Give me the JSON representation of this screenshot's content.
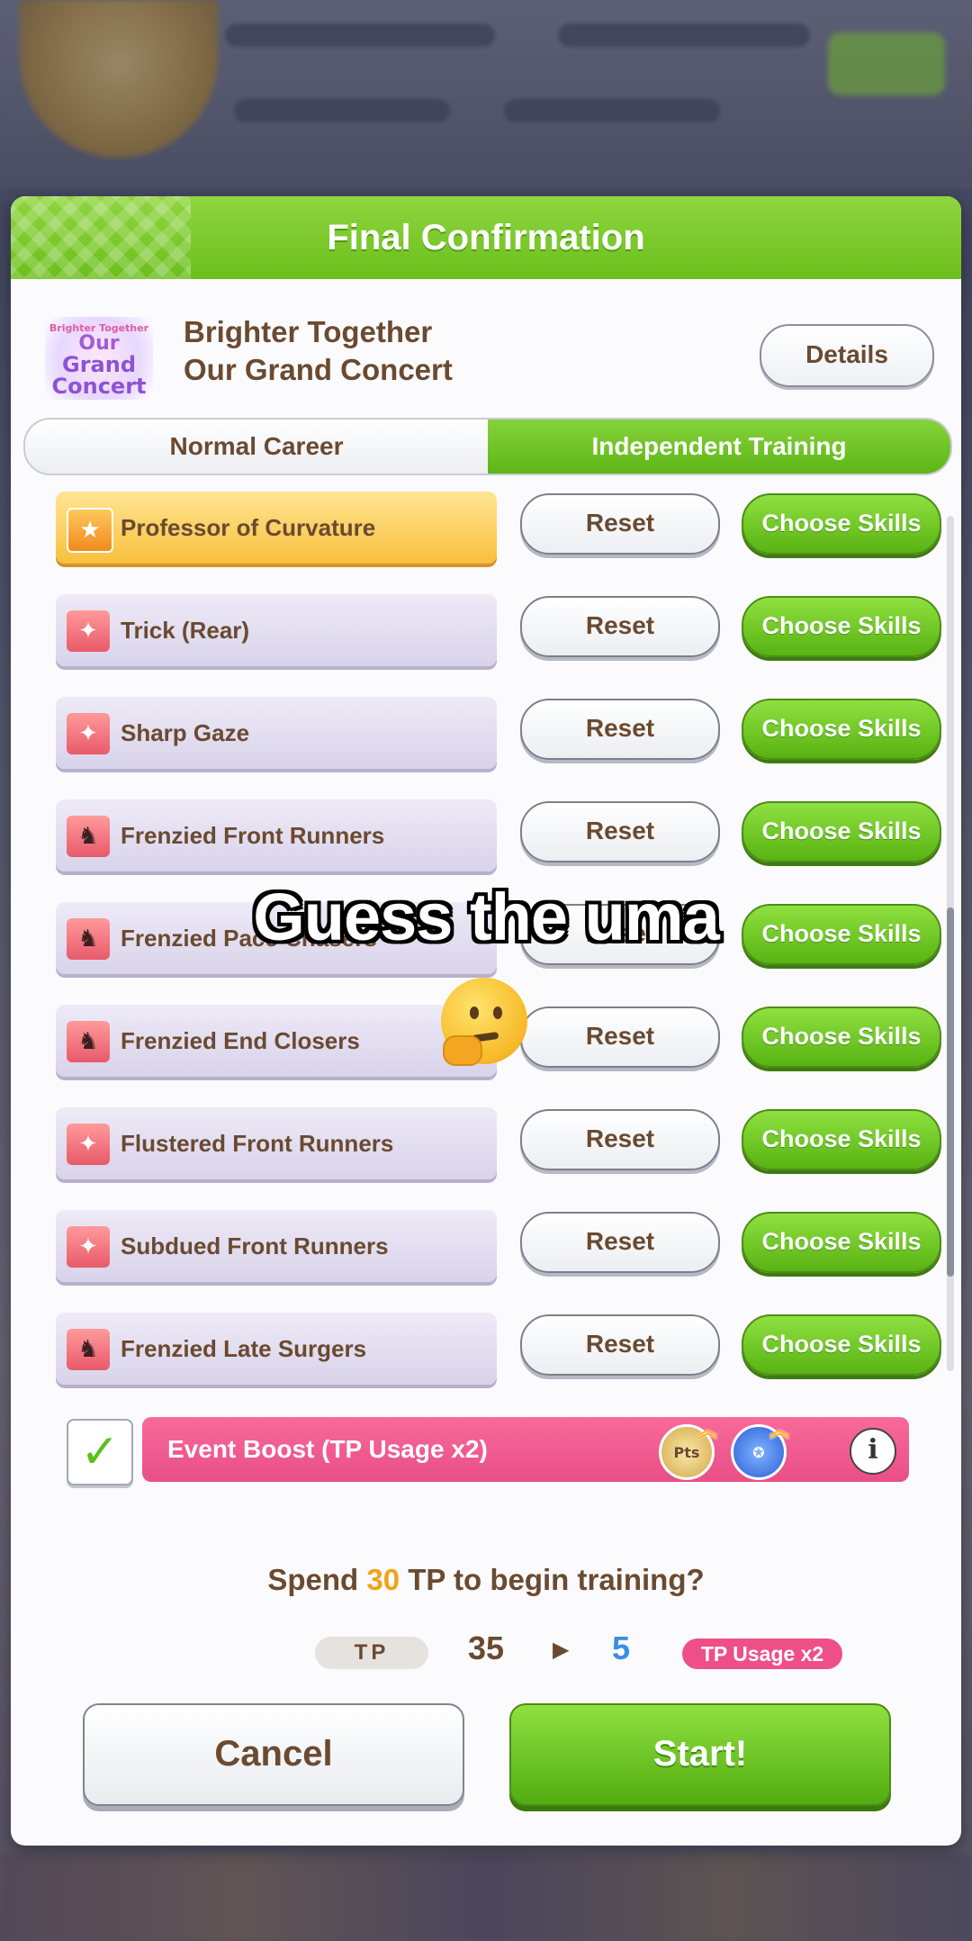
{
  "dialog": {
    "title": "Final Confirmation",
    "event_logo": {
      "line1": "Brighter Together",
      "line2": "Our",
      "line3": "Grand",
      "line4": "Concert"
    },
    "event_name_line1": "Brighter Together",
    "event_name_line2": "Our Grand Concert",
    "details_label": "Details",
    "tabs": [
      {
        "label": "Normal Career",
        "selected": false
      },
      {
        "label": "Independent Training",
        "selected": true
      }
    ],
    "skills": [
      {
        "name": "Professor of Curvature",
        "icon": "gold-speed-icon",
        "reset_label": "Reset",
        "choose_label": "Choose Skills",
        "highlight": true
      },
      {
        "name": "Trick (Rear)",
        "icon": "sparkle-debuff-icon",
        "reset_label": "Reset",
        "choose_label": "Choose Skills"
      },
      {
        "name": "Sharp Gaze",
        "icon": "sparkle-debuff-icon",
        "reset_label": "Reset",
        "choose_label": "Choose Skills"
      },
      {
        "name": "Frenzied Front Runners",
        "icon": "frenzy-debuff-icon",
        "reset_label": "Reset",
        "choose_label": "Choose Skills"
      },
      {
        "name": "Frenzied Pace Chasers",
        "icon": "frenzy-debuff-icon",
        "reset_label": "Reset",
        "choose_label": "Choose Skills"
      },
      {
        "name": "Frenzied End Closers",
        "icon": "frenzy-debuff-icon",
        "reset_label": "Reset",
        "choose_label": "Choose Skills"
      },
      {
        "name": "Flustered Front Runners",
        "icon": "sparkle-debuff-icon",
        "reset_label": "Reset",
        "choose_label": "Choose Skills"
      },
      {
        "name": "Subdued Front Runners",
        "icon": "sparkle-debuff-icon",
        "reset_label": "Reset",
        "choose_label": "Choose Skills"
      },
      {
        "name": "Frenzied Late Surgers",
        "icon": "frenzy-debuff-icon",
        "reset_label": "Reset",
        "choose_label": "Choose Skills"
      }
    ],
    "event_boost": {
      "checked": true,
      "label": "Event Boost (TP Usage x2)",
      "pts_icon_label": "Pts",
      "info_label": "i"
    },
    "confirm": {
      "spend_prefix": "Spend ",
      "spend_amount": "30",
      "spend_suffix": " TP to begin training?",
      "tp_label": "TP",
      "tp_from": "35",
      "tp_to": "5",
      "tp_usage_badge": "TP Usage x2"
    },
    "cancel_label": "Cancel",
    "start_label": "Start!"
  },
  "overlay": {
    "caption": "Guess the uma"
  },
  "colors": {
    "header_green": "#6cbf1c",
    "accent_green": "#58b312",
    "boost_pink": "#e94f85",
    "text_brown": "#6a4a30",
    "tp_blue": "#3b8de0",
    "tp_orange": "#f0a21a"
  }
}
